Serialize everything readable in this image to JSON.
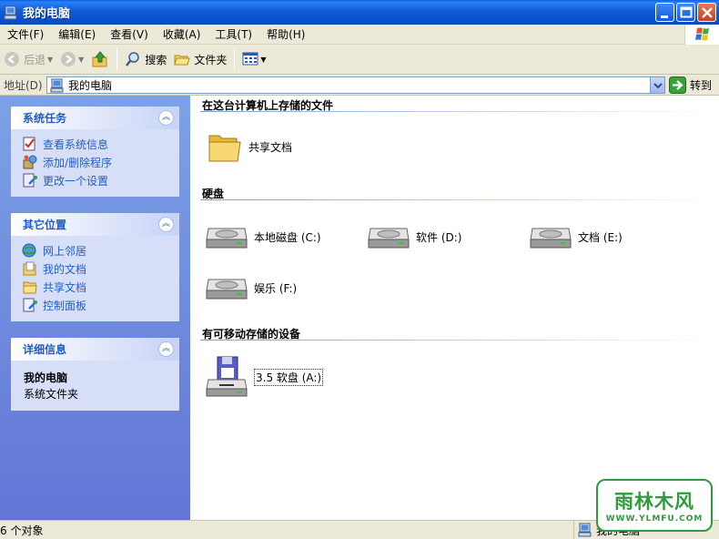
{
  "window": {
    "title": "我的电脑"
  },
  "menu": [
    "文件(F)",
    "编辑(E)",
    "查看(V)",
    "收藏(A)",
    "工具(T)",
    "帮助(H)"
  ],
  "toolbar": {
    "back": "后退",
    "search": "搜索",
    "folders": "文件夹"
  },
  "address": {
    "label": "地址(D)",
    "value": "我的电脑",
    "go": "转到"
  },
  "sidebar": {
    "system_tasks": {
      "title": "系统任务",
      "items": [
        "查看系统信息",
        "添加/删除程序",
        "更改一个设置"
      ]
    },
    "other_places": {
      "title": "其它位置",
      "items": [
        "网上邻居",
        "我的文档",
        "共享文档",
        "控制面板"
      ]
    },
    "details": {
      "title": "详细信息",
      "name": "我的电脑",
      "type": "系统文件夹"
    }
  },
  "groups": {
    "stored_files": {
      "title": "在这台计算机上存储的文件",
      "items": [
        "共享文档"
      ]
    },
    "hard_disks": {
      "title": "硬盘",
      "items": [
        "本地磁盘 (C:)",
        "软件 (D:)",
        "文档 (E:)",
        "娱乐 (F:)"
      ]
    },
    "removable": {
      "title": "有可移动存储的设备",
      "items": [
        "3.5 软盘 (A:)"
      ]
    }
  },
  "status": {
    "count": "6 个对象",
    "zone": "我的电脑"
  },
  "watermark": {
    "brand": "雨林木风",
    "url": "WWW.YLMFU.COM"
  },
  "colors": {
    "title_bar": "#0a4fcf",
    "sidebar_link": "#215dc6",
    "sidebar_bg": "#6375d6"
  }
}
